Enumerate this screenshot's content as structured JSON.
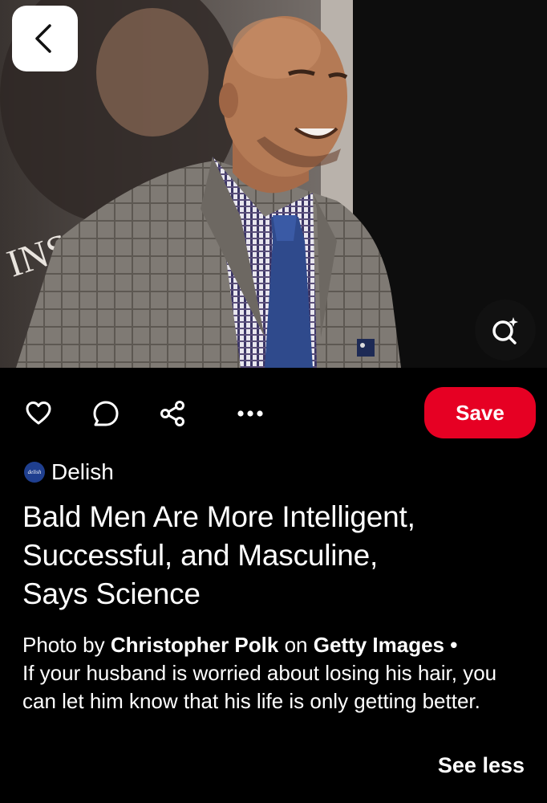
{
  "image": {
    "alt": "Smiling bald man in a plaid grey suit and blue tie",
    "backdrop_text": "INSON"
  },
  "icons": {
    "back": "chevron-left-icon",
    "visual_search": "lens-search-icon",
    "like": "heart-icon",
    "comment": "comment-icon",
    "share": "share-icon",
    "more": "more-horizontal-icon"
  },
  "actions": {
    "save_label": "Save"
  },
  "source": {
    "logo_text": "delish",
    "name": "Delish"
  },
  "pin": {
    "title_line1": "Bald Men Are More Intelligent,",
    "title_line2": "Successful, and Masculine,",
    "title_line3": "Says Science",
    "photo_prefix": "Photo by ",
    "photographer": "Christopher Polk",
    "photo_on": " on ",
    "photo_agency": "Getty Images",
    "bullet": " •",
    "description": "If your husband is worried about losing his hair, you can let him know that his life is only getting better.",
    "see_less": "See less"
  },
  "colors": {
    "background": "#000000",
    "save_button": "#e60023",
    "text": "#ffffff"
  }
}
